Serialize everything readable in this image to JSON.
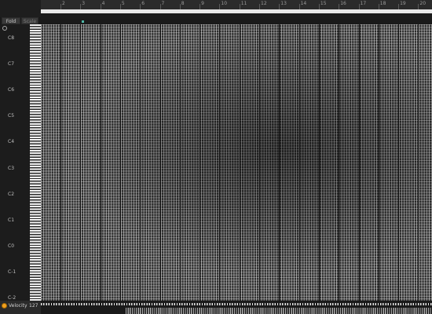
{
  "toolbar": {
    "fold_label": "Fold",
    "scale_label": "Scale"
  },
  "ruler": {
    "bars": [
      "2",
      "3",
      "4",
      "5",
      "6",
      "7",
      "8",
      "9",
      "10",
      "11",
      "12",
      "13",
      "14",
      "15",
      "16",
      "17",
      "18",
      "19",
      "20"
    ]
  },
  "keyboard": {
    "octave_labels": [
      "C8",
      "C7",
      "C6",
      "C5",
      "C4",
      "C3",
      "C2",
      "C1",
      "C0",
      "C-1",
      "C-2"
    ]
  },
  "velocity": {
    "label": "Velocity",
    "value": "127"
  },
  "colors": {
    "accent": "#f0a020",
    "playhead": "#4fb8a8",
    "loop_bar": "#e9e9e9"
  },
  "icons": {
    "fold": "circle-icon",
    "velocity_toggle": "orange-dot-icon"
  }
}
